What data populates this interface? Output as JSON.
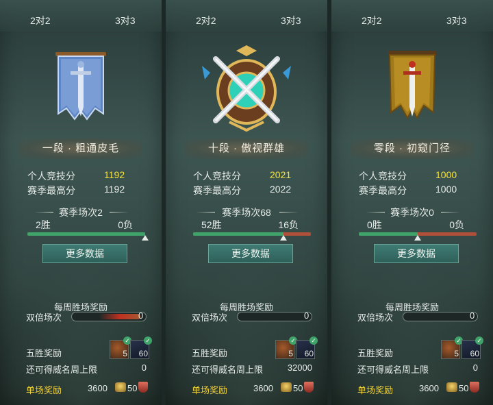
{
  "panels": [
    {
      "tabs": {
        "two": "2对2",
        "three": "3对3"
      },
      "rank": "一段 · 粗通皮毛",
      "personal_label": "个人竞技分",
      "personal_value": "1192",
      "best_label": "赛季最高分",
      "best_value": "1192",
      "season_label": "赛季场次2",
      "wins": "2胜",
      "losses": "0负",
      "win_ratio": 1.0,
      "more_button": "更多数据",
      "weekly_title": "每周胜场奖励",
      "double_label": "双倍场次",
      "double_value": "0",
      "five_label": "五胜奖励",
      "item1_count": "5",
      "item2_count": "60",
      "cap_label": "还可得威名周上限",
      "cap_value": "0",
      "single_label": "单场奖励",
      "gold_value": "3600",
      "honor_value": "50",
      "emblem": "blue-banner-sword"
    },
    {
      "tabs": {
        "two": "2对2",
        "three": "3对3"
      },
      "rank": "十段 · 傲视群雄",
      "personal_label": "个人竞技分",
      "personal_value": "2021",
      "best_label": "赛季最高分",
      "best_value": "2022",
      "season_label": "赛季场次68",
      "wins": "52胜",
      "losses": "16负",
      "win_ratio": 0.765,
      "more_button": "更多数据",
      "weekly_title": "每周胜场奖励",
      "double_label": "双倍场次",
      "double_value": "0",
      "five_label": "五胜奖励",
      "item1_count": "5",
      "item2_count": "60",
      "cap_label": "还可得威名周上限",
      "cap_value": "32000",
      "single_label": "单场奖励",
      "gold_value": "3600",
      "honor_value": "50",
      "emblem": "golden-crossed-swords-shield"
    },
    {
      "tabs": {
        "two": "2对2",
        "three": "3对3"
      },
      "rank": "零段 · 初窥门径",
      "personal_label": "个人竞技分",
      "personal_value": "1000",
      "best_label": "赛季最高分",
      "best_value": "1000",
      "season_label": "赛季场次0",
      "wins": "0胜",
      "losses": "0负",
      "win_ratio": 0.5,
      "more_button": "更多数据",
      "weekly_title": "每周胜场奖励",
      "double_label": "双倍场次",
      "double_value": "0",
      "five_label": "五胜奖励",
      "item1_count": "5",
      "item2_count": "60",
      "cap_label": "还可得威名周上限",
      "cap_value": "0",
      "single_label": "单场奖励",
      "gold_value": "3600",
      "honor_value": "50",
      "emblem": "gold-banner-sword"
    }
  ],
  "colors": {
    "win": "#3fa36a",
    "loss": "#b0503a",
    "highlight": "#f5e23a",
    "reward_label": "#f0d23c"
  }
}
